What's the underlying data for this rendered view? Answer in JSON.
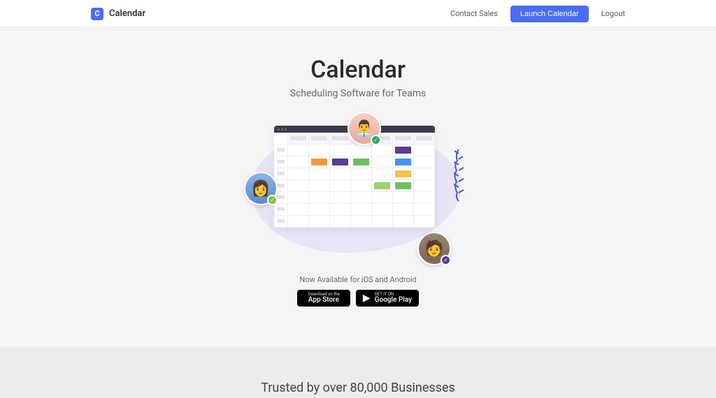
{
  "header": {
    "brand": "Calendar",
    "contact_sales": "Contact Sales",
    "launch": "Launch Calendar",
    "logout": "Logout"
  },
  "hero": {
    "title": "Calendar",
    "subtitle": "Scheduling Software for Teams"
  },
  "availability": "Now Available for iOS and Android",
  "stores": {
    "apple": {
      "line1": "Download on the",
      "line2": "App Store"
    },
    "google": {
      "line1": "GET IT ON",
      "line2": "Google Play"
    }
  },
  "trust": {
    "headline": "Trusted by over 80,000 Businesses"
  }
}
